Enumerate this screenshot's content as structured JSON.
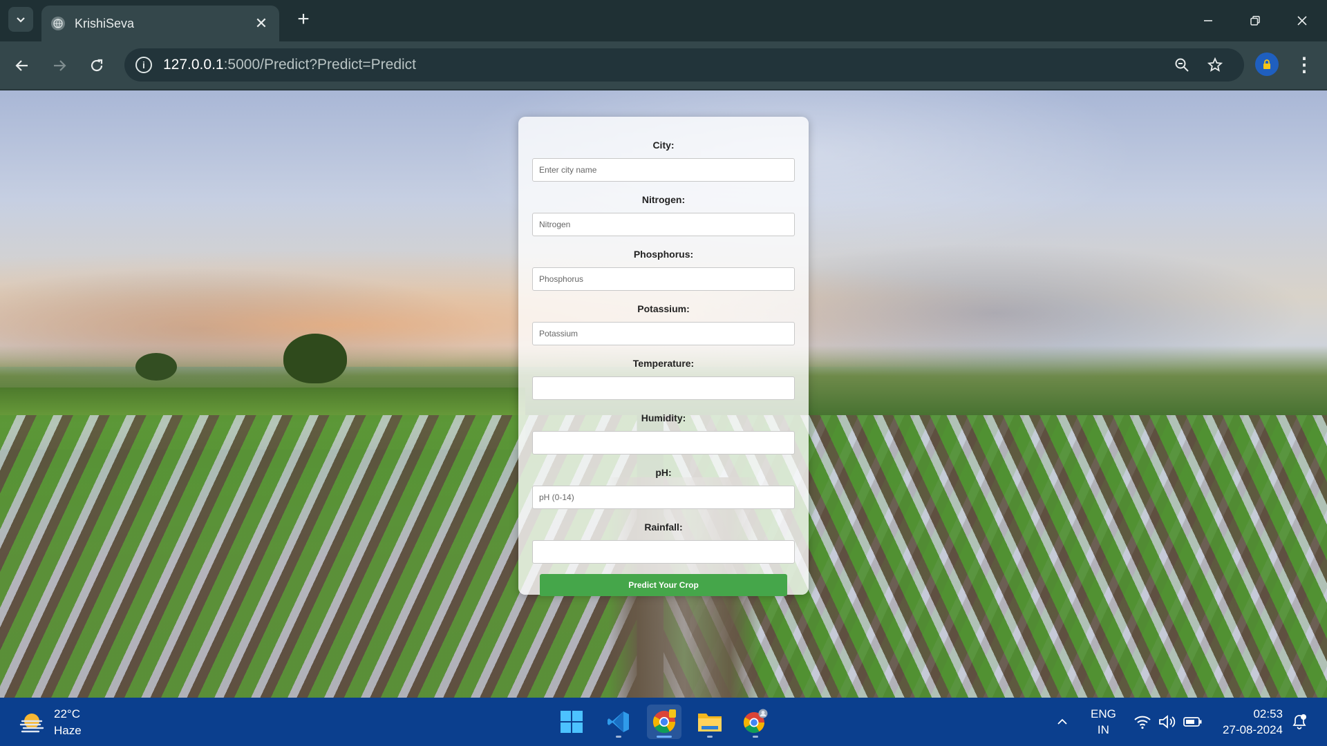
{
  "browser": {
    "tab_title": "KrishiSeva",
    "url_host": "127.0.0.1",
    "url_rest": ":5000/Predict?Predict=Predict"
  },
  "form": {
    "fields": [
      {
        "label": "City:",
        "placeholder": "Enter city name"
      },
      {
        "label": "Nitrogen:",
        "placeholder": "Nitrogen"
      },
      {
        "label": "Phosphorus:",
        "placeholder": "Phosphorus"
      },
      {
        "label": "Potassium:",
        "placeholder": "Potassium"
      },
      {
        "label": "Temperature:",
        "placeholder": ""
      },
      {
        "label": "Humidity:",
        "placeholder": ""
      },
      {
        "label": "pH:",
        "placeholder": "pH (0-14)"
      },
      {
        "label": "Rainfall:",
        "placeholder": ""
      }
    ],
    "submit_label": "Predict Your Crop",
    "submit_color": "#45a64a"
  },
  "taskbar": {
    "weather_temp": "22°C",
    "weather_desc": "Haze",
    "lang_top": "ENG",
    "lang_bottom": "IN",
    "time": "02:53",
    "date": "27-08-2024",
    "apps": [
      "windows-start-icon",
      "vscode-icon",
      "chrome-icon",
      "file-explorer-icon",
      "chrome-profile-icon"
    ]
  }
}
